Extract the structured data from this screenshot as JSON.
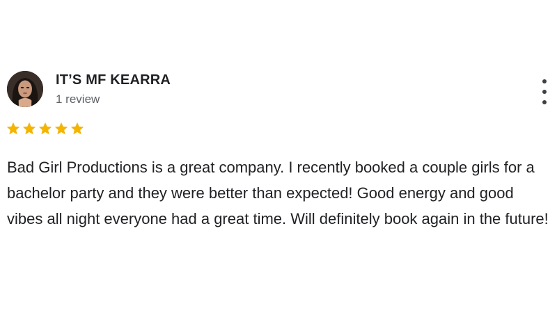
{
  "review": {
    "reviewer_name": "IT’S MF KEARRA",
    "review_count": "1 review",
    "rating": 5,
    "rating_max": 5,
    "star_color": "#f5b400",
    "text": "Bad Girl Productions is a great company. I recently booked a couple girls for a bachelor party and they were better than expected! Good energy and good vibes all night everyone had a great time. Will definitely book again in the future!",
    "more_icon": "more-vert-icon",
    "avatar_icon": "profile-photo"
  }
}
